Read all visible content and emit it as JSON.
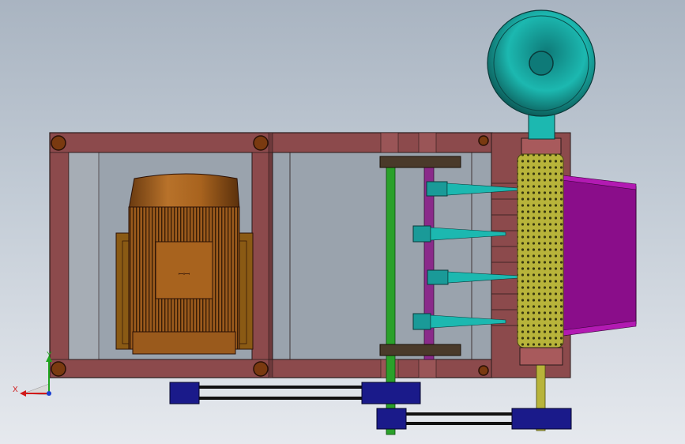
{
  "viewport": {
    "background_top": "#a9b4c1",
    "background_bottom": "#e6e9ee"
  },
  "triad": {
    "x_label": "X",
    "y_label": "Y",
    "x_color": "#d11a1a",
    "y_color": "#1fa61f",
    "z_color": "#1a3fd1"
  },
  "motor": {
    "nameplate_text": "ꟷꟷ"
  },
  "colors": {
    "frame": "#8c4a4c",
    "motor": "#a8631e",
    "screen_drum": "#b8b43a",
    "hopper": "#1cb8b0",
    "outlet_chute": "#8a0d8a",
    "green_shaft": "#2aa12a",
    "purple_shaft": "#8a2a8a",
    "belt_pulley": "#1a1a8a"
  }
}
